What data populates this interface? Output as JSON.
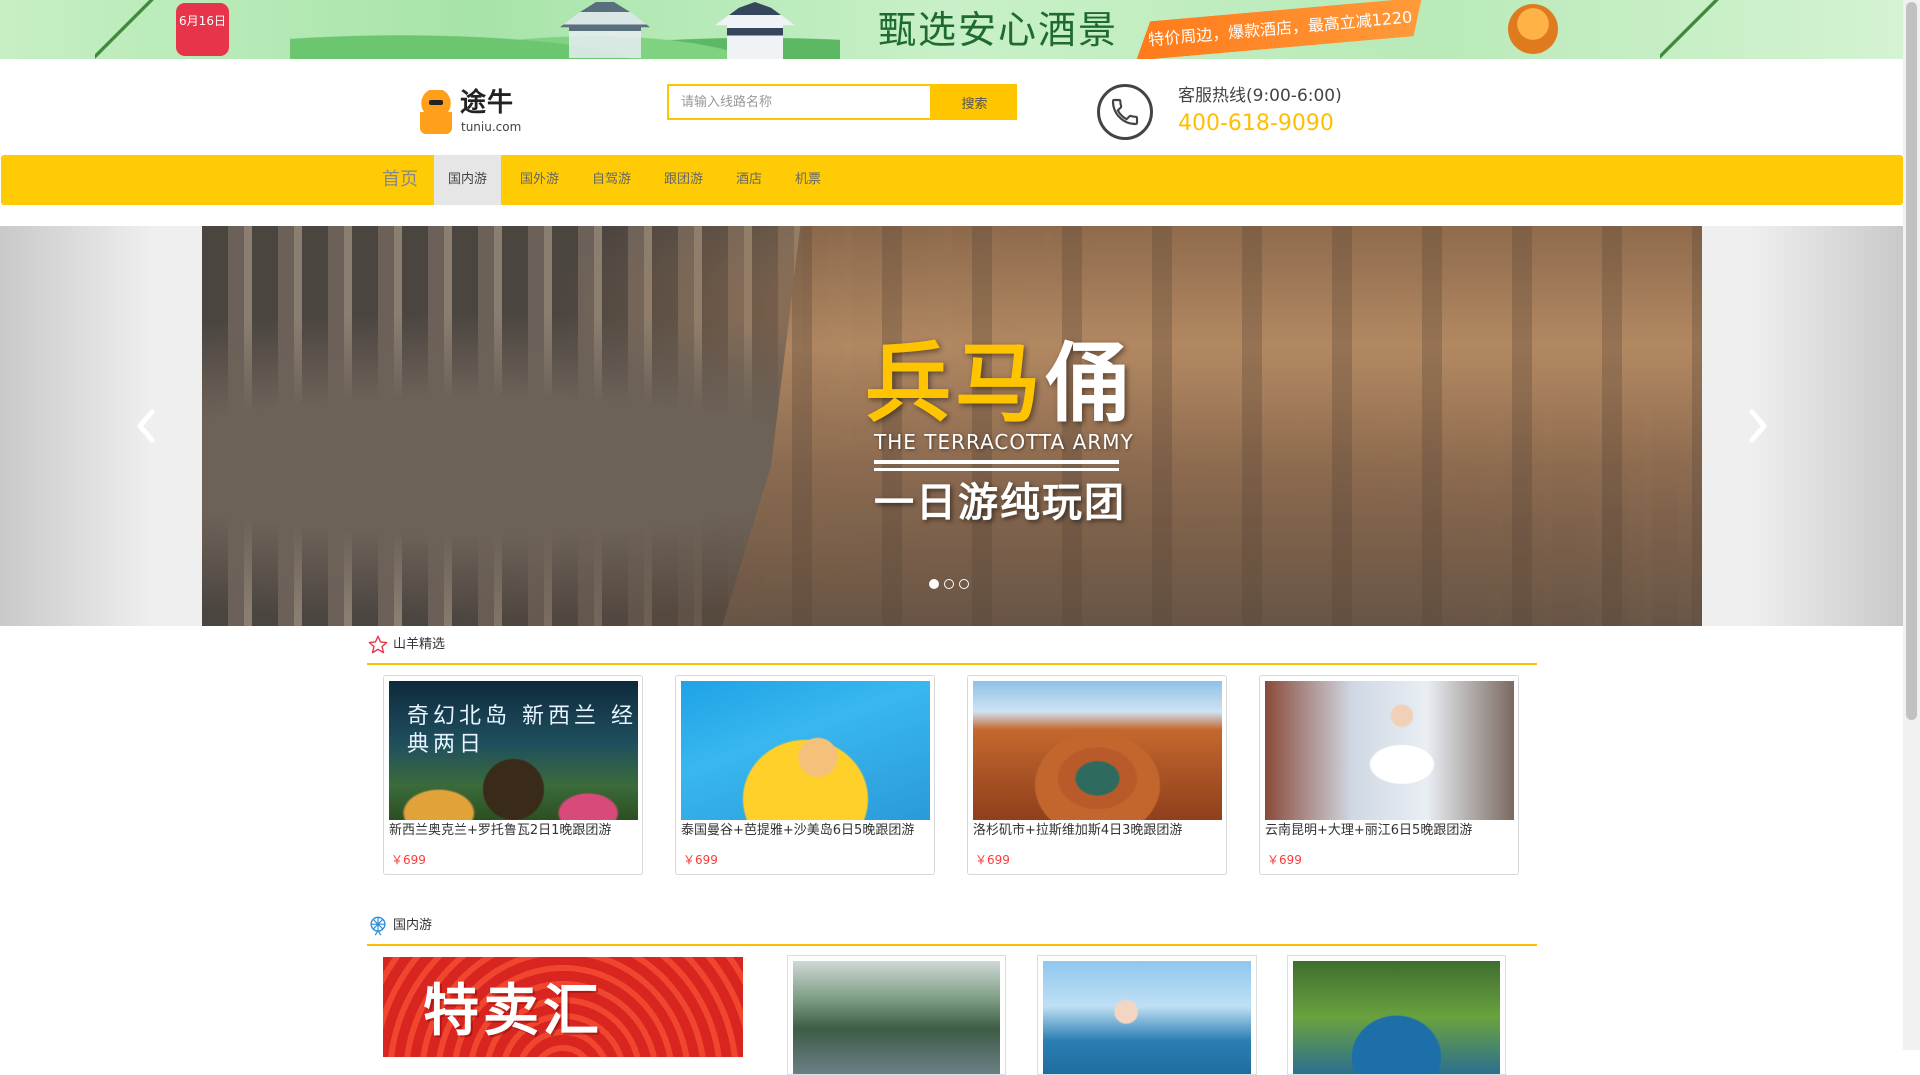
{
  "promo_banner": {
    "badge_text": "6月16日",
    "slogan": "甄选安心酒景",
    "tag": "特价周边，爆款酒店，最高立减1220元",
    "bg_color": "#b7e9b6"
  },
  "header": {
    "logo_cn": "途牛",
    "logo_en": "tuniu.com",
    "search_placeholder": "请输入线路名称",
    "search_button": "搜索",
    "hotline_label": "客服热线(9:00-6:00)",
    "hotline_number": "400-618-9090",
    "accent_color": "#ffcb05"
  },
  "nav": {
    "items": [
      {
        "label": "首页"
      },
      {
        "label": "国内游",
        "active": true
      },
      {
        "label": "国外游"
      },
      {
        "label": "自驾游"
      },
      {
        "label": "跟团游"
      },
      {
        "label": "酒店"
      },
      {
        "label": "机票"
      }
    ]
  },
  "carousel": {
    "title_cn": "兵马俑",
    "title_en": "THE TERRACOTTA ARMY",
    "subtitle": "一日游纯玩团",
    "active_slide": 1,
    "slide_count": 3,
    "prev_icon": "chevron-left-icon",
    "next_icon": "chevron-right-icon"
  },
  "featured": {
    "title": "山羊精选",
    "icon": "star-icon",
    "items": [
      {
        "name": "新西兰奥克兰+罗托鲁瓦2日1晚跟团游",
        "price": "￥699",
        "image_caption": "奇幻北岛 新西兰 经典两日"
      },
      {
        "name": "泰国曼谷+芭提雅+沙美岛6日5晚跟团游",
        "price": "￥699"
      },
      {
        "name": "洛杉矶市+拉斯维加斯4日3晚跟团游",
        "price": "￥699"
      },
      {
        "name": "云南昆明+大理+丽江6日5晚跟团游",
        "price": "￥699"
      }
    ]
  },
  "domestic": {
    "title": "国内游",
    "icon": "ferris-wheel-icon",
    "promo_text": "特卖汇"
  }
}
